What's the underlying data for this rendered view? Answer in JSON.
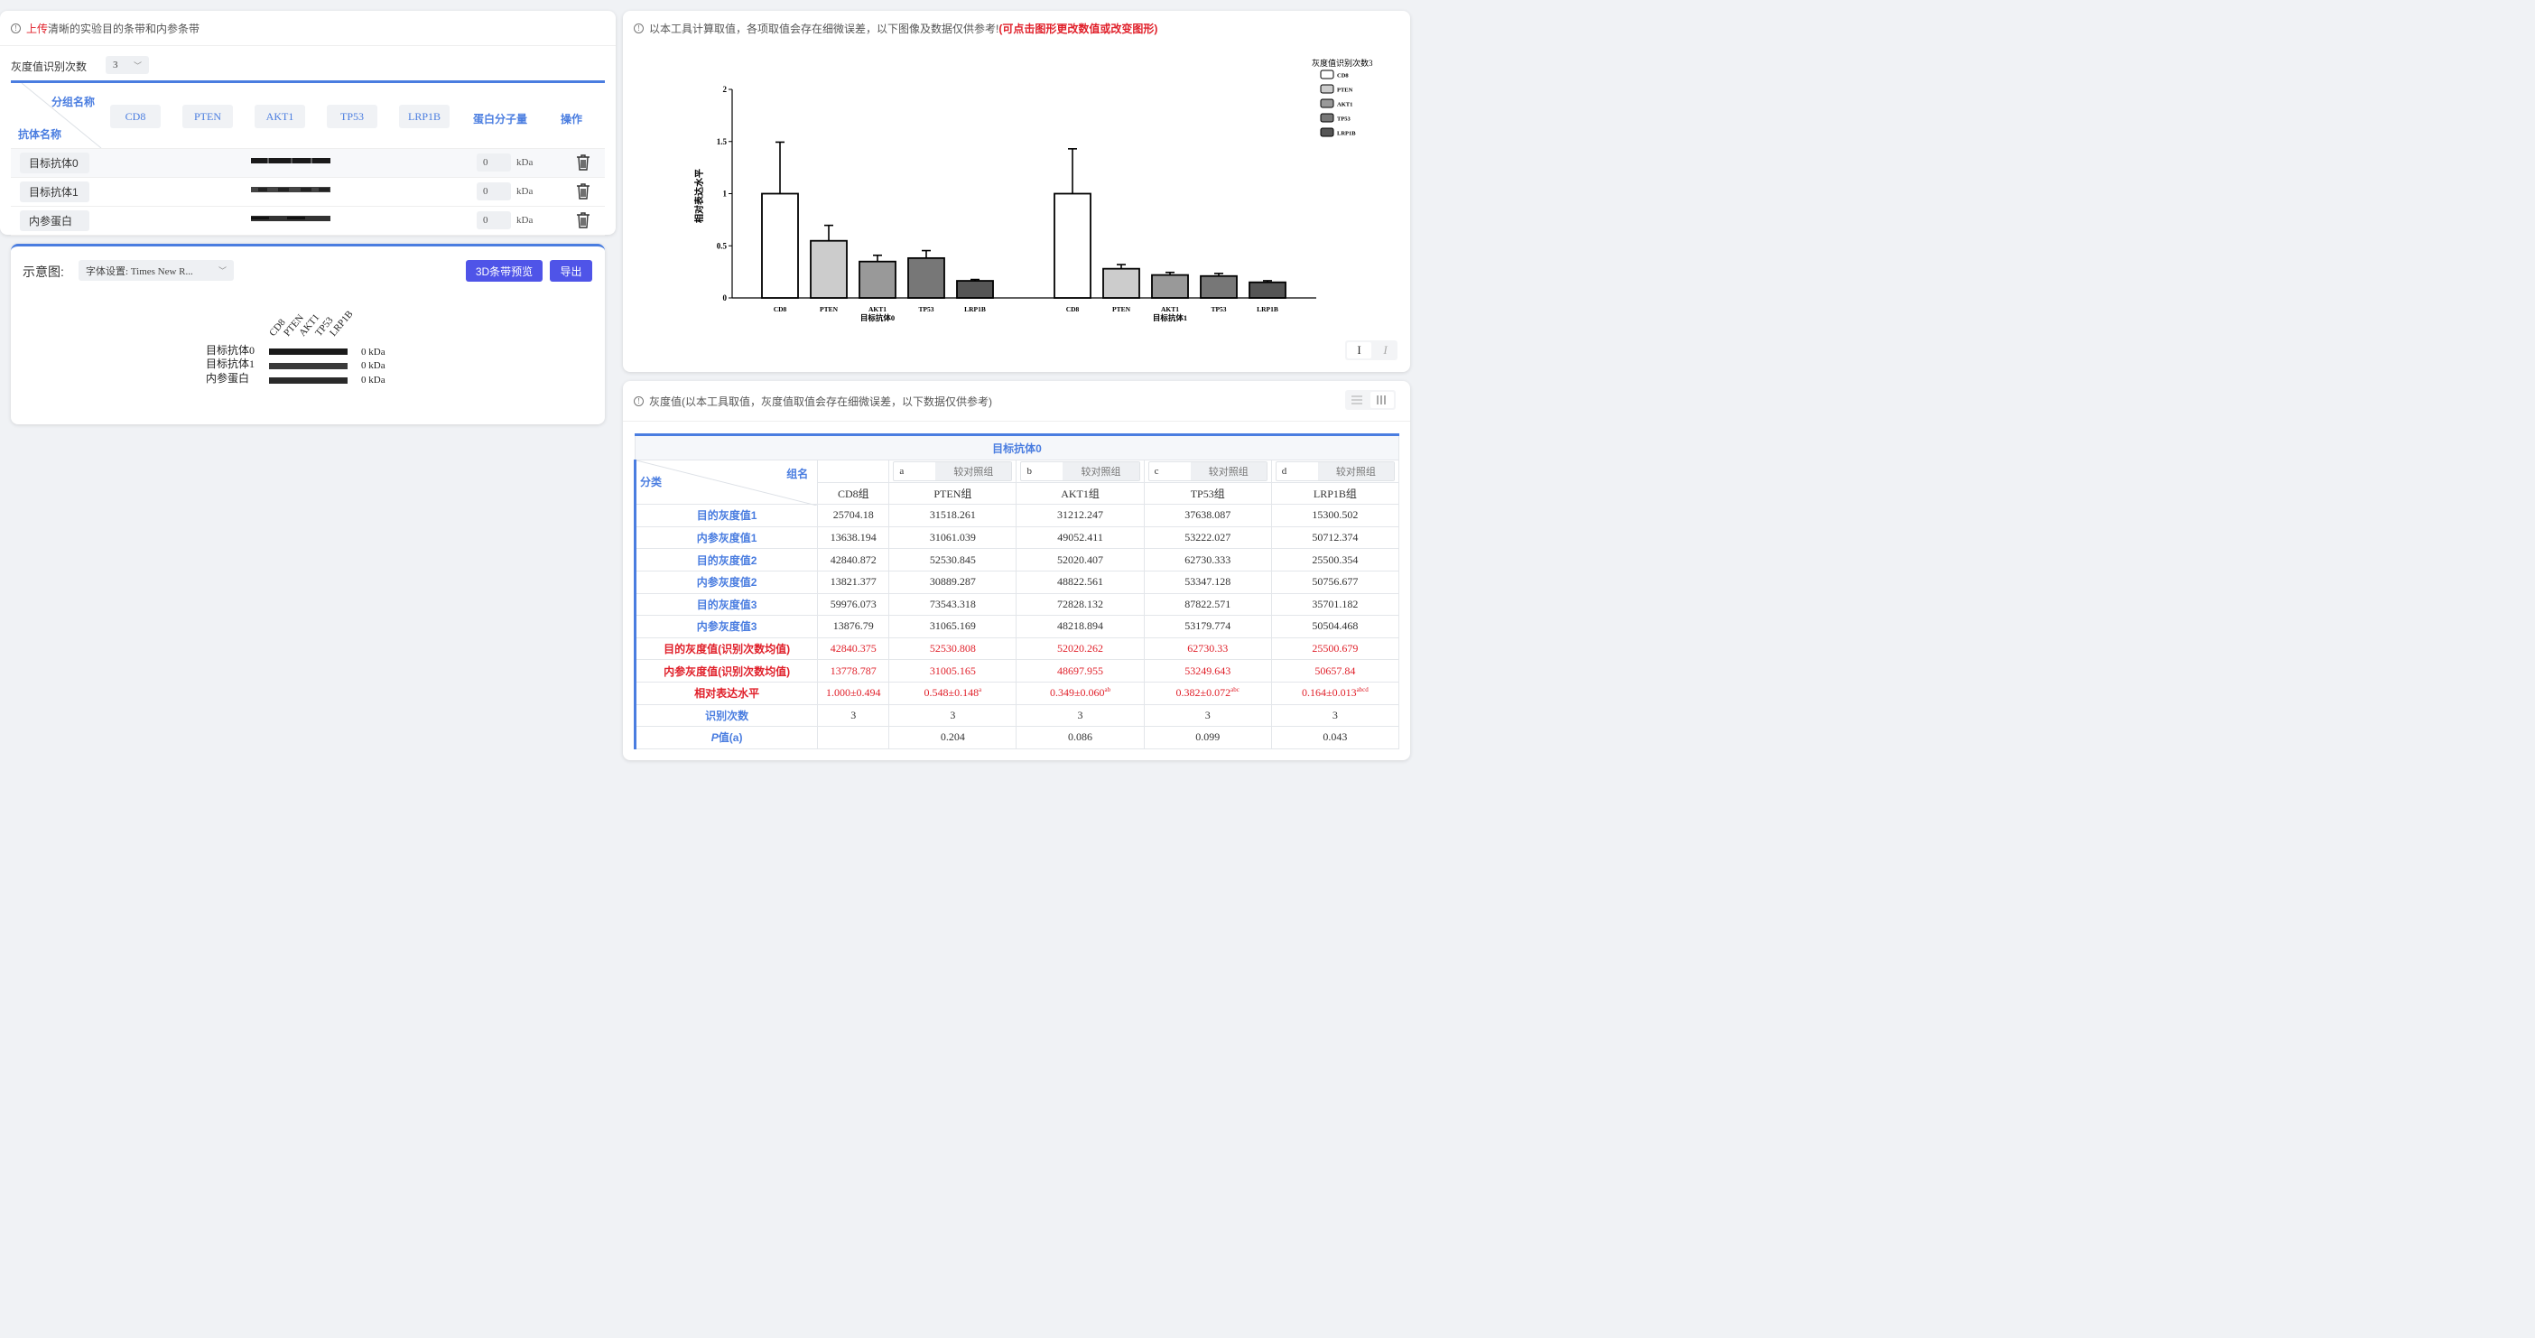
{
  "upload_panel": {
    "title_red": "上传",
    "title_rest": "清晰的实验目的条带和内参条带",
    "count_label": "灰度值识别次数",
    "count_value": "3",
    "header_group": "分组名称",
    "header_antibody": "抗体名称",
    "groups": [
      "CD8",
      "PTEN",
      "AKT1",
      "TP53",
      "LRP1B"
    ],
    "mw_header": "蛋白分子量",
    "op_header": "操作",
    "rows": [
      {
        "name": "目标抗体0",
        "mw": "0",
        "unit": "kDa"
      },
      {
        "name": "目标抗体1",
        "mw": "0",
        "unit": "kDa"
      },
      {
        "name": "内参蛋白",
        "mw": "0",
        "unit": "kDa"
      }
    ]
  },
  "schematic": {
    "label": "示意图:",
    "font_select": "字体设置: Times New R...",
    "btn_3d": "3D条带预览",
    "btn_export": "导出",
    "lane_labels": [
      "CD8",
      "PTEN",
      "AKT1",
      "TP53",
      "LRP1B"
    ],
    "rows": [
      {
        "name": "目标抗体0",
        "mw": "0 kDa"
      },
      {
        "name": "目标抗体1",
        "mw": "0 kDa"
      },
      {
        "name": "内参蛋白",
        "mw": "0 kDa"
      }
    ]
  },
  "chart_panel": {
    "title_text": "以本工具计算取值，各项取值会存在细微误差，以下图像及数据仅供参考!",
    "title_red": "(可点击图形更改数值或改变图形)",
    "bold_icon": "I",
    "italic_icon": "I"
  },
  "chart_data": {
    "type": "bar",
    "ylabel": "相对表达水平",
    "ylim": [
      0,
      2
    ],
    "yticks": [
      "0",
      "0.5",
      "1",
      "1.5",
      "2"
    ],
    "legend_title": "灰度值识别次数3",
    "legend_position": "top-right",
    "categories": [
      "CD8",
      "PTEN",
      "AKT1",
      "TP53",
      "LRP1B"
    ],
    "colors": [
      "#ffffff",
      "#cccccc",
      "#999999",
      "#777777",
      "#555555"
    ],
    "groups": [
      {
        "name": "目标抗体0",
        "values": [
          1.0,
          0.548,
          0.349,
          0.382,
          0.164
        ],
        "errors": [
          0.494,
          0.148,
          0.06,
          0.072,
          0.013
        ]
      },
      {
        "name": "目标抗体1",
        "values": [
          1.0,
          0.28,
          0.22,
          0.21,
          0.15
        ],
        "errors": [
          0.43,
          0.04,
          0.025,
          0.025,
          0.015
        ]
      }
    ]
  },
  "gray_panel": {
    "title": "灰度值(以本工具取值，灰度值取值会存在细微误差，以下数据仅供参考)",
    "table_title": "目标抗体0",
    "corner_group": "组名",
    "corner_cat": "分类",
    "compare_letters": [
      "a",
      "b",
      "c",
      "d"
    ],
    "compare_label": "较对照组",
    "group_names": [
      "CD8组",
      "PTEN组",
      "AKT1组",
      "TP53组",
      "LRP1B组"
    ],
    "rows": [
      {
        "label": "目的灰度值1",
        "cells": [
          "25704.18",
          "31518.261",
          "31212.247",
          "37638.087",
          "15300.502"
        ]
      },
      {
        "label": "内参灰度值1",
        "cells": [
          "13638.194",
          "31061.039",
          "49052.411",
          "53222.027",
          "50712.374"
        ]
      },
      {
        "label": "目的灰度值2",
        "cells": [
          "42840.872",
          "52530.845",
          "52020.407",
          "62730.333",
          "25500.354"
        ]
      },
      {
        "label": "内参灰度值2",
        "cells": [
          "13821.377",
          "30889.287",
          "48822.561",
          "53347.128",
          "50756.677"
        ]
      },
      {
        "label": "目的灰度值3",
        "cells": [
          "59976.073",
          "73543.318",
          "72828.132",
          "87822.571",
          "35701.182"
        ]
      },
      {
        "label": "内参灰度值3",
        "cells": [
          "13876.79",
          "31065.169",
          "48218.894",
          "53179.774",
          "50504.468"
        ]
      }
    ],
    "red_rows": [
      {
        "label": "目的灰度值(识别次数均值)",
        "cells": [
          "42840.375",
          "52530.808",
          "52020.262",
          "62730.33",
          "25500.679"
        ]
      },
      {
        "label": "内参灰度值(识别次数均值)",
        "cells": [
          "13778.787",
          "31005.165",
          "48697.955",
          "53249.643",
          "50657.84"
        ]
      }
    ],
    "expr_row": {
      "label": "相对表达水平",
      "cells": [
        "1.000±0.494",
        "0.548±0.148",
        "0.349±0.060",
        "0.382±0.072",
        "0.164±0.013"
      ],
      "sups": [
        "",
        "a",
        "ab",
        "abc",
        "abcd"
      ]
    },
    "count_row": {
      "label": "识别次数",
      "cells": [
        "3",
        "3",
        "3",
        "3",
        "3"
      ]
    },
    "p_row": {
      "label_italic": "P",
      "label_rest": "值(a)",
      "cells": [
        "",
        "0.204",
        "0.086",
        "0.099",
        "0.043"
      ]
    }
  }
}
